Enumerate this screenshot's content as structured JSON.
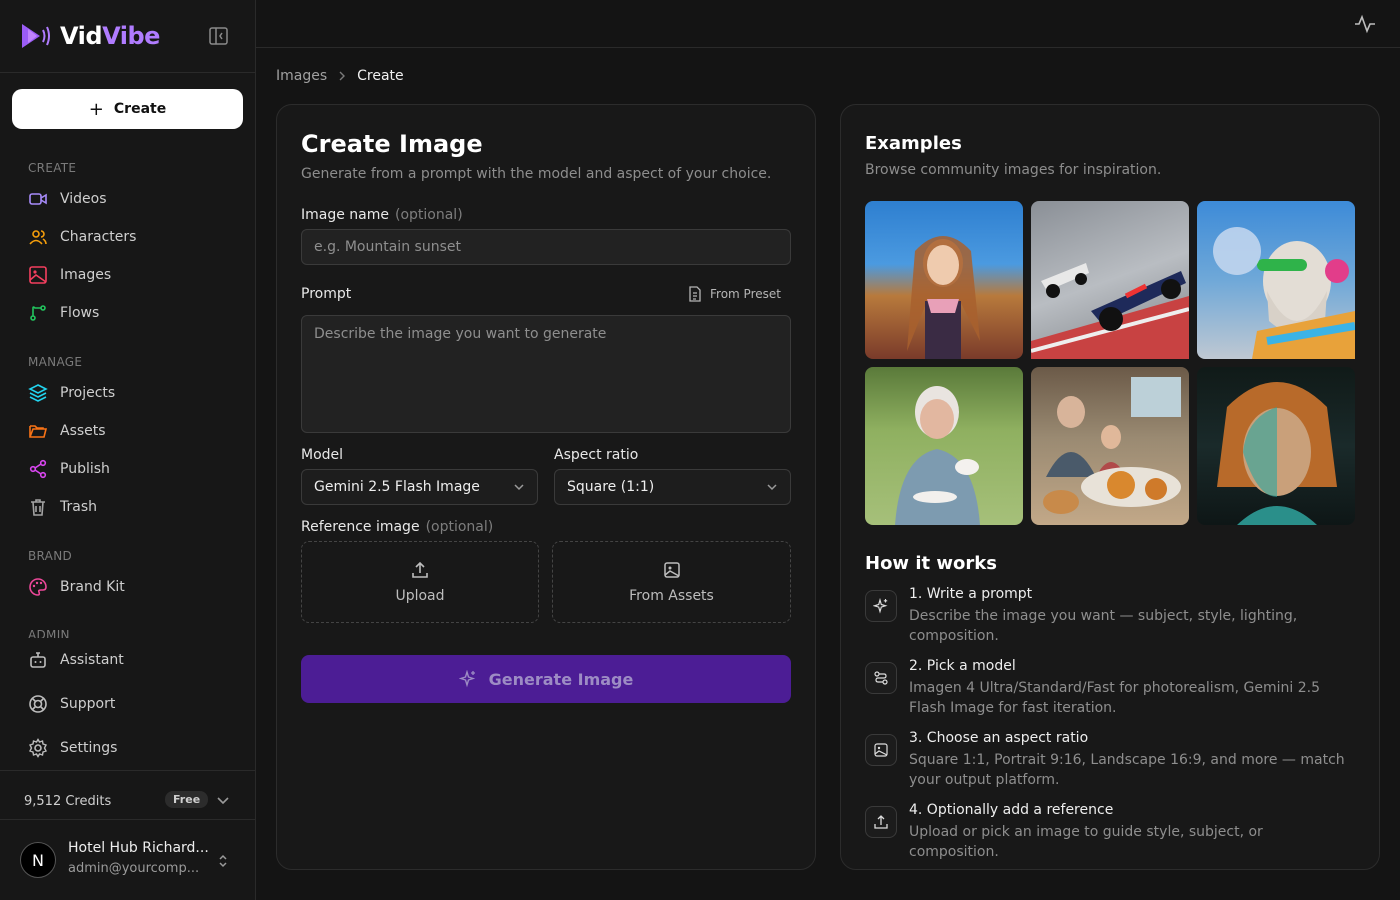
{
  "app": {
    "name_main": "Vid",
    "name_accent": "Vibe"
  },
  "sidebar": {
    "create_label": "Create",
    "sections": {
      "create": "CREATE",
      "manage": "MANAGE",
      "brand": "BRAND",
      "admin": "ADMIN"
    },
    "items": {
      "videos": "Videos",
      "characters": "Characters",
      "images": "Images",
      "flows": "Flows",
      "projects": "Projects",
      "assets": "Assets",
      "publish": "Publish",
      "trash": "Trash",
      "brand_kit": "Brand Kit",
      "assistant": "Assistant",
      "support": "Support",
      "settings": "Settings"
    },
    "credits": "9,512 Credits",
    "plan": "Free",
    "user": {
      "initial": "N",
      "name": "Hotel Hub Richard...",
      "email": "admin@yourcomp..."
    }
  },
  "breadcrumb": {
    "parent": "Images",
    "current": "Create"
  },
  "form": {
    "title": "Create Image",
    "subtitle": "Generate from a prompt with the model and aspect of your choice.",
    "name_label": "Image name",
    "optional": "(optional)",
    "name_placeholder": "e.g. Mountain sunset",
    "prompt_label": "Prompt",
    "from_preset": "From Preset",
    "prompt_placeholder": "Describe the image you want to generate",
    "model_label": "Model",
    "model_value": "Gemini 2.5 Flash Image",
    "aspect_label": "Aspect ratio",
    "aspect_value": "Square (1:1)",
    "reference_label": "Reference image",
    "upload_label": "Upload",
    "from_assets_label": "From Assets",
    "generate_label": "Generate Image"
  },
  "examples": {
    "title": "Examples",
    "subtitle": "Browse community images for inspiration."
  },
  "how": {
    "title": "How it works",
    "steps": [
      {
        "title": "1. Write a prompt",
        "desc": "Describe the image you want — subject, style, lighting, composition."
      },
      {
        "title": "2. Pick a model",
        "desc": "Imagen 4 Ultra/Standard/Fast for photorealism, Gemini 2.5 Flash Image for fast iteration."
      },
      {
        "title": "3. Choose an aspect ratio",
        "desc": "Square 1:1, Portrait 9:16, Landscape 16:9, and more — match your output platform."
      },
      {
        "title": "4. Optionally add a reference",
        "desc": "Upload or pick an image to guide style, subject, or composition."
      }
    ]
  },
  "colors": {
    "accent": "#b07cff",
    "generate_bg": "#4c1d95",
    "bg": "#141414"
  }
}
